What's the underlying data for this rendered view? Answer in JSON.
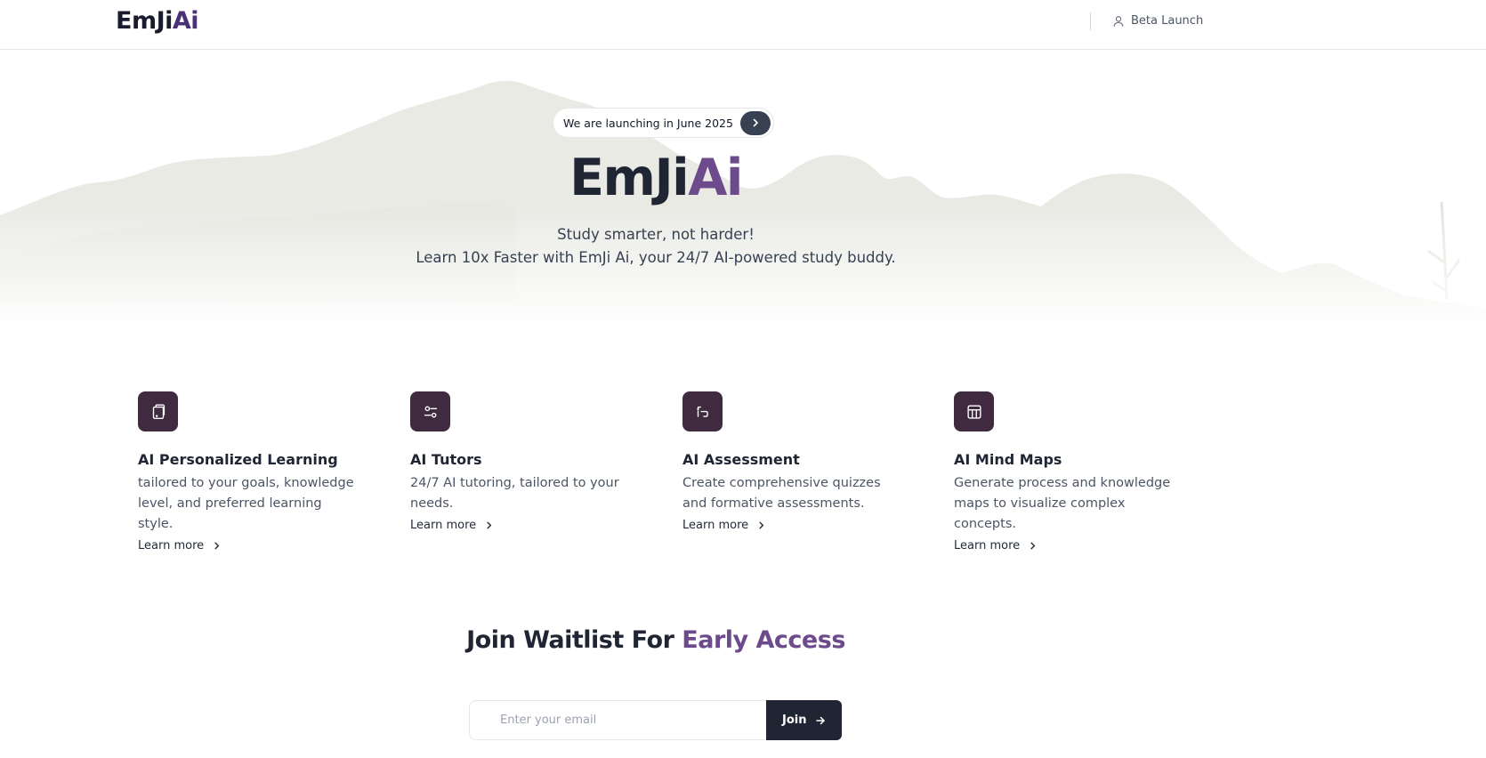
{
  "header": {
    "logo_main": "EmJi",
    "logo_accent": "Ai",
    "beta_label": "Beta Launch",
    "beta_icon": "user-icon"
  },
  "hero": {
    "pill_text": "We are launching in June 2025",
    "pill_icon": "chevron-right-icon",
    "title_main": "EmJi",
    "title_accent": "Ai",
    "subtitle_line1": "Study smarter, not harder!",
    "subtitle_line2": "Learn 10x Faster with EmJi Ai, your 24/7 AI-powered study buddy."
  },
  "features": [
    {
      "icon": "tablet-icon",
      "title": "AI Personalized Learning",
      "description": "tailored to your goals, knowledge level, and preferred learning style.",
      "link": "Learn more"
    },
    {
      "icon": "sliders-icon",
      "title": "AI Tutors",
      "description": "24/7 AI tutoring, tailored to your needs.",
      "link": "Learn more"
    },
    {
      "icon": "assessment-icon",
      "title": "AI Assessment",
      "description": "Create comprehensive quizzes and formative assessments.",
      "link": "Learn more"
    },
    {
      "icon": "table-icon",
      "title": "AI Mind Maps",
      "description": "Generate process and knowledge maps to visualize complex concepts.",
      "link": "Learn more"
    }
  ],
  "waitlist": {
    "title_main": "Join Waitlist For ",
    "title_accent": "Early Access",
    "email_placeholder": "Enter your email",
    "email_value": "",
    "join_label": "Join"
  },
  "colors": {
    "accent": "#6d4a8c",
    "logo_accent": "#4a3075",
    "dark": "#1f2533",
    "icon_box": "#3f2a40",
    "mountains": "#e9eae4"
  }
}
